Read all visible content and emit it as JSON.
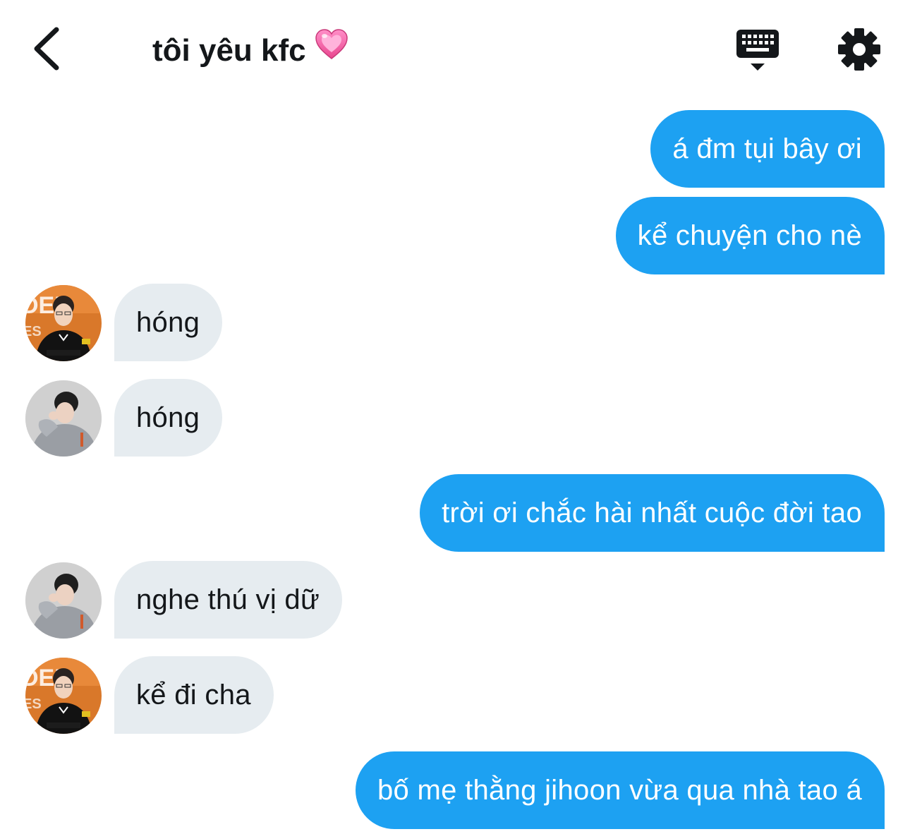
{
  "header": {
    "title": "tôi yêu kfc",
    "back_icon": "chevron-left-icon",
    "title_emoji_icon": "growing-heart-icon",
    "keyboard_icon": "keyboard-hide-icon",
    "settings_icon": "gear-icon"
  },
  "colors": {
    "sent_bubble": "#1da1f2",
    "received_bubble": "#e6ecf0",
    "text_dark": "#14171a"
  },
  "messages": [
    {
      "direction": "sent",
      "text": "á đm tụi bây ơi"
    },
    {
      "direction": "sent",
      "text": "kể chuyện cho nè"
    },
    {
      "direction": "received",
      "avatar": "avatar-orange-background",
      "text": "hóng"
    },
    {
      "direction": "received",
      "avatar": "avatar-gray-background",
      "text": "hóng"
    },
    {
      "direction": "sent",
      "text": "trời ơi chắc hài nhất cuộc đời tao"
    },
    {
      "direction": "received",
      "avatar": "avatar-gray-background",
      "text": "nghe thú vị dữ"
    },
    {
      "direction": "received",
      "avatar": "avatar-orange-background",
      "text": "kể đi cha"
    },
    {
      "direction": "sent",
      "text": "bố mẹ thằng jihoon vừa qua nhà tao á"
    }
  ]
}
